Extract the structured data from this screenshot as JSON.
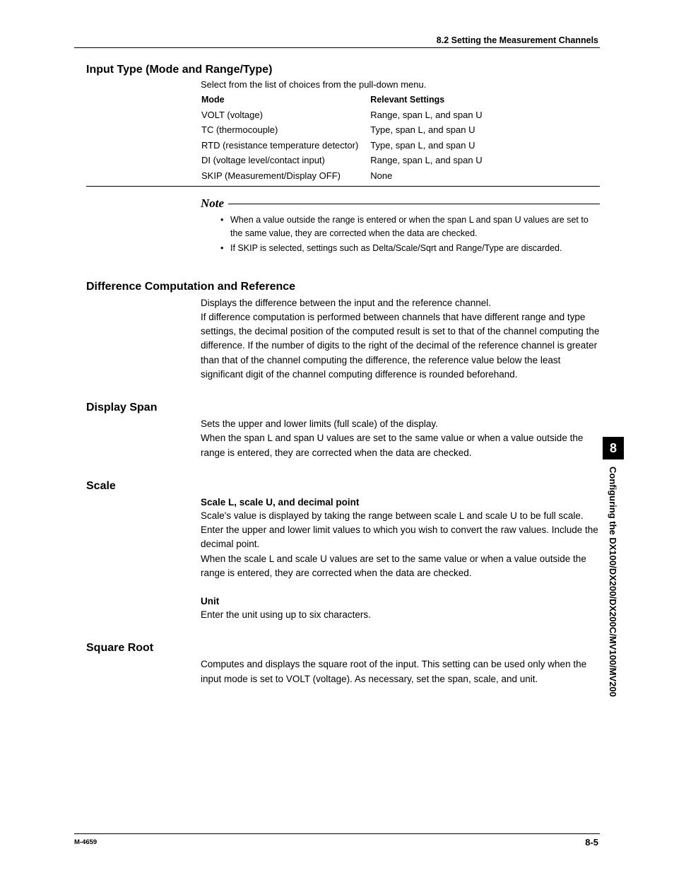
{
  "header": {
    "section_ref": "8.2  Setting the Measurement Channels"
  },
  "sections": {
    "input_type": {
      "title": "Input Type (Mode and Range/Type)",
      "intro": "Select from the list of choices from the pull-down menu.",
      "col1": "Mode",
      "col2": "Relevant Settings",
      "rows": [
        {
          "mode": "VOLT (voltage)",
          "settings": "Range, span L, and span U"
        },
        {
          "mode": "TC (thermocouple)",
          "settings": "Type, span L, and span U"
        },
        {
          "mode": "RTD (resistance temperature detector)",
          "settings": "Type, span L, and span U"
        },
        {
          "mode": "DI (voltage level/contact input)",
          "settings": "Range, span L, and span U"
        },
        {
          "mode": "SKIP (Measurement/Display OFF)",
          "settings": "None"
        }
      ],
      "note_label": "Note",
      "notes": [
        "When a value outside the range is entered or when the span L and span U values are set to the same value, they are corrected when the data are checked.",
        "If SKIP is selected, settings such as Delta/Scale/Sqrt and Range/Type are discarded."
      ]
    },
    "diff": {
      "title": "Difference Computation and Reference",
      "p1": "Displays the difference between the input and the reference channel.",
      "p2": "If difference computation is performed between channels that have different range and type settings, the decimal position of the computed result is set to that of the channel computing the difference.  If the number of digits to the right of the decimal of the reference channel is greater than that of the channel computing the difference, the reference value below the least significant digit of the channel computing difference is rounded beforehand."
    },
    "display_span": {
      "title": "Display Span",
      "p1": "Sets the upper and lower limits (full scale) of the display.",
      "p2": "When the span L and span U values are set to the same value or when a value outside the range is entered, they are corrected when the data are checked."
    },
    "scale": {
      "title": "Scale",
      "sub1": "Scale L, scale U, and decimal point",
      "p1": "Scale's value is displayed by taking the range between scale L and scale U to be full scale.  Enter the upper and lower limit values to which you wish to convert the raw values.  Include the decimal point.",
      "p2": "When the scale L and scale U values are set to the same value or when a value outside the range is entered, they are corrected when the data are checked.",
      "sub2": "Unit",
      "p3": "Enter the unit using up to six characters."
    },
    "sqrt": {
      "title": "Square Root",
      "p1": "Computes and displays the square root of the input.  This setting can be used only when the input mode is set to VOLT (voltage).  As necessary, set the span, scale, and unit."
    }
  },
  "side": {
    "chapter": "8",
    "label": "Configuring the DX100/DX200/DX200C/MV100/MV200"
  },
  "footer": {
    "left": "M-4659",
    "right": "8-5"
  }
}
